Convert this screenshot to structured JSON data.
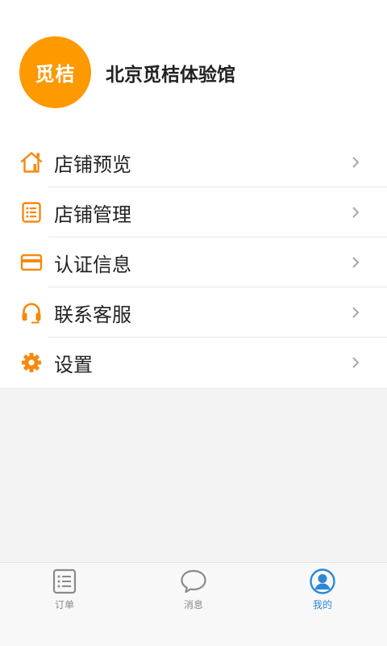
{
  "profile": {
    "avatar_text": "觅桔",
    "shop_name": "北京觅桔体验馆"
  },
  "menu": {
    "items": [
      {
        "label": "店铺预览",
        "icon": "home-icon"
      },
      {
        "label": "店铺管理",
        "icon": "list-icon"
      },
      {
        "label": "认证信息",
        "icon": "card-icon"
      },
      {
        "label": "联系客服",
        "icon": "headset-icon"
      },
      {
        "label": "设置",
        "icon": "gear-icon"
      }
    ]
  },
  "tabbar": {
    "tabs": [
      {
        "label": "订单",
        "icon": "order-list-icon",
        "active": false
      },
      {
        "label": "消息",
        "icon": "message-bubble-icon",
        "active": false
      },
      {
        "label": "我的",
        "icon": "user-profile-icon",
        "active": true
      }
    ]
  },
  "colors": {
    "accent": "#ff9900",
    "icon_orange": "#f5890f",
    "tab_active": "#2d87d6",
    "tab_inactive": "#8a8a8a"
  }
}
